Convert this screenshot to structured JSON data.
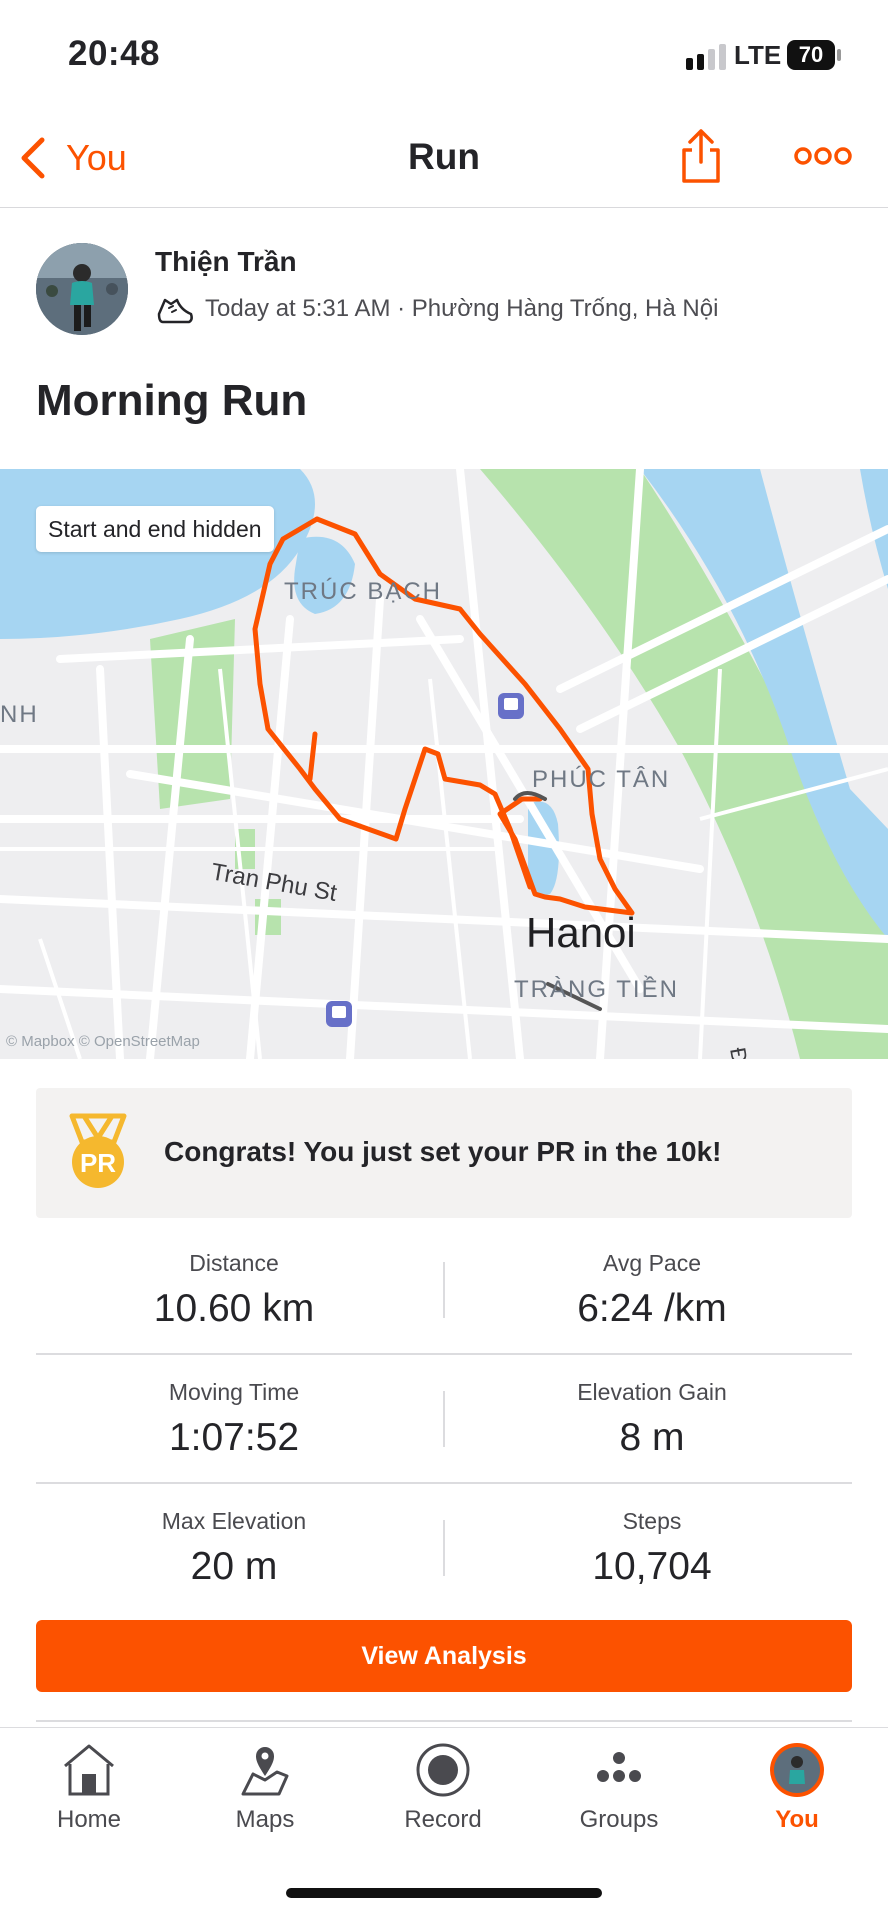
{
  "status_bar": {
    "time": "20:48",
    "carrier": "LTE",
    "battery": "70"
  },
  "nav": {
    "back_label": "You",
    "title": "Run"
  },
  "athlete": {
    "name": "Thiện Trần",
    "meta": "Today at 5:31 AM · Phường Hàng Trống, Hà Nội"
  },
  "activity": {
    "title": "Morning Run"
  },
  "map": {
    "badge": "Start and end hidden",
    "attribution": "© Mapbox © OpenStreetMap",
    "labels": [
      "TRÚC BẠCH",
      "PHÚC TÂN",
      "Tran Phu St",
      "Hanoi",
      "TRÀNG TIỀN",
      "NH",
      "Đ"
    ]
  },
  "pr": {
    "text": "Congrats! You just set your PR in the 10k!",
    "medal_label": "PR"
  },
  "stats": [
    {
      "label": "Distance",
      "value": "10.60 km"
    },
    {
      "label": "Avg Pace",
      "value": "6:24 /km"
    },
    {
      "label": "Moving Time",
      "value": "1:07:52"
    },
    {
      "label": "Elevation Gain",
      "value": "8 m"
    },
    {
      "label": "Max Elevation",
      "value": "20 m"
    },
    {
      "label": "Steps",
      "value": "10,704"
    }
  ],
  "view_analysis_label": "View Analysis",
  "tabs": [
    {
      "label": "Home"
    },
    {
      "label": "Maps"
    },
    {
      "label": "Record"
    },
    {
      "label": "Groups"
    },
    {
      "label": "You"
    }
  ],
  "colors": {
    "accent": "#fc5200",
    "route": "#fc5200",
    "water": "#a6d5f2",
    "park": "#b7e3ad"
  }
}
